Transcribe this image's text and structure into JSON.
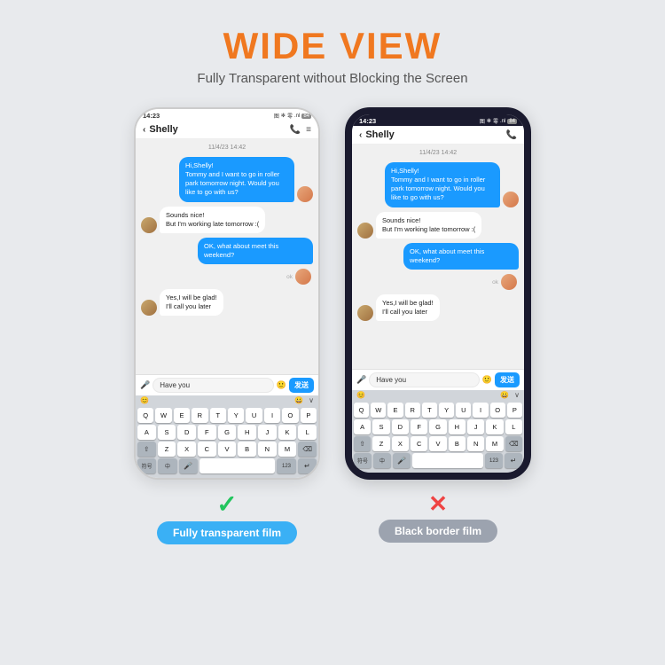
{
  "header": {
    "title": "WIDE VIEW",
    "subtitle": "Fully Transparent without Blocking the Screen"
  },
  "phones": {
    "left": {
      "status_time": "14:23",
      "status_icons": "图 ※ 零 .nl 84",
      "chat_name": "Shelly",
      "chat_date": "11/4/23 14:42",
      "messages": [
        {
          "type": "sent",
          "text": "Hi,Shelly!\nTommy and I want to go in roller park tomorrow night. Would you like to go with us?"
        },
        {
          "type": "received",
          "text": "Sounds nice!\nBut I'm working late tomorrow :("
        },
        {
          "type": "sent",
          "text": "OK, what about meet this weekend?"
        },
        {
          "type": "received",
          "text": "Yes,I will be glad!\nI'll call you later"
        },
        {
          "type": "ok",
          "text": "ok"
        }
      ],
      "input_text": "Have you",
      "send_label": "发送"
    },
    "right": {
      "status_time": "14:23",
      "status_icons": "图 ※ 零 .nl 84",
      "chat_name": "Shelly",
      "chat_date": "11/4/23 14:42",
      "messages": [
        {
          "type": "sent",
          "text": "Hi,Shelly!\nTommy and I want to go in roller park tomorrow night. Would you like to go with us?"
        },
        {
          "type": "received",
          "text": "Sounds nice!\nBut I'm working late tomorrow :("
        },
        {
          "type": "sent",
          "text": "OK, what about meet this weekend?"
        },
        {
          "type": "received",
          "text": "Yes,I will be glad!\nI'll call you later"
        },
        {
          "type": "ok",
          "text": "ok"
        }
      ],
      "input_text": "Have you",
      "send_label": "发送"
    }
  },
  "labels": {
    "left_checkmark": "✓",
    "right_cross": "✕",
    "left_label": "Fully transparent film",
    "right_label": "Black border film"
  },
  "keyboard": {
    "row1": [
      "Q",
      "W",
      "E",
      "R",
      "T",
      "Y",
      "U",
      "I",
      "O",
      "P"
    ],
    "row2": [
      "A",
      "S",
      "D",
      "F",
      "G",
      "H",
      "J",
      "K",
      "L"
    ],
    "row3": [
      "Z",
      "X",
      "C",
      "V",
      "B",
      "N",
      "M"
    ],
    "bottom": [
      "符号",
      "中",
      "mic",
      "123",
      "⏎"
    ]
  }
}
